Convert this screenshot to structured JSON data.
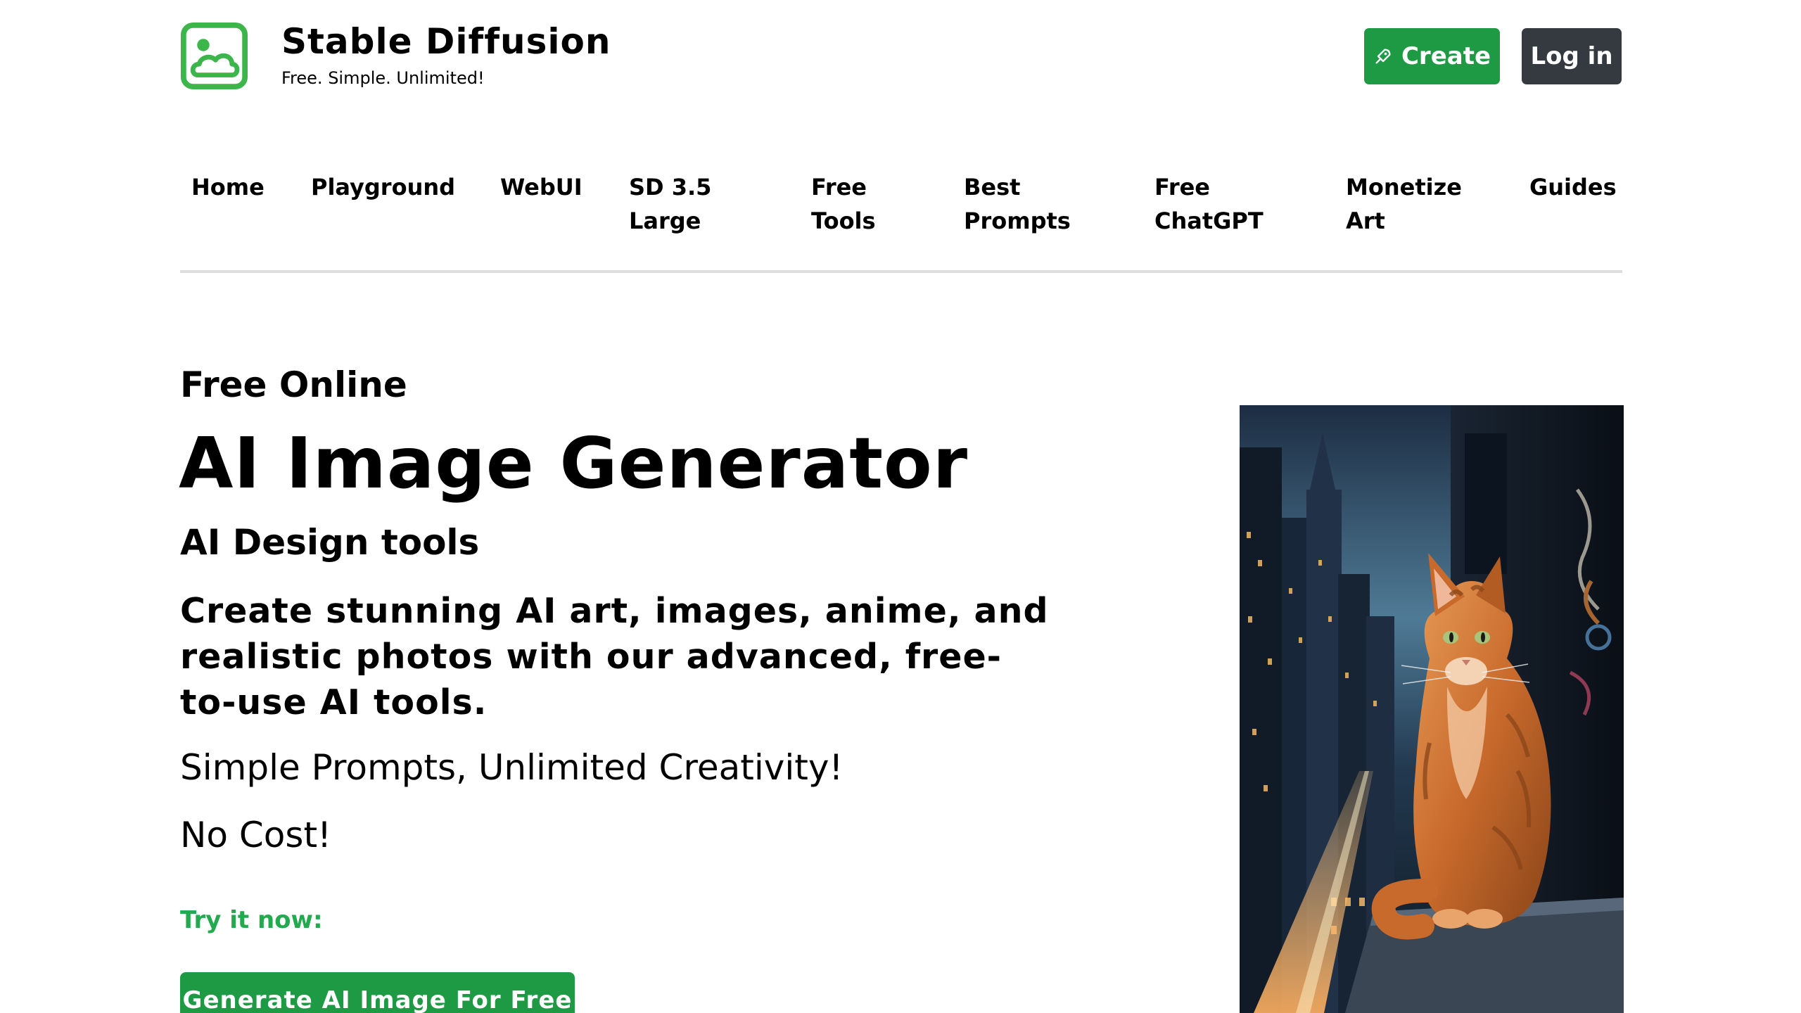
{
  "header": {
    "brand_title": "Stable Diffusion",
    "brand_tagline": "Free. Simple. Unlimited!",
    "logo_icon": "image-cloud-icon",
    "create_label": "Create",
    "create_icon": "rocket-icon",
    "login_label": "Log in"
  },
  "nav": {
    "items": [
      {
        "line1": "Home",
        "line2": ""
      },
      {
        "line1": "Playground",
        "line2": ""
      },
      {
        "line1": "WebUI",
        "line2": ""
      },
      {
        "line1": "SD 3.5",
        "line2": "Large"
      },
      {
        "line1": "Free",
        "line2": "Tools"
      },
      {
        "line1": "Best",
        "line2": "Prompts"
      },
      {
        "line1": "Free",
        "line2": "ChatGPT"
      },
      {
        "line1": "Monetize",
        "line2": "Art"
      },
      {
        "line1": "Guides",
        "line2": ""
      }
    ]
  },
  "hero": {
    "kicker": "Free Online",
    "headline": "AI Image Generator",
    "subhead": "AI Design tools",
    "description": "Create stunning AI art, images, anime, and realistic photos with our advanced, free-to-use AI tools.",
    "line1": "Simple Prompts, Unlimited Creativity!",
    "line2": "No Cost!",
    "try_label": "Try it now:",
    "cta_label": "Generate AI Image For Free",
    "image_subject": "orange tabby cat on a city window ledge at night"
  },
  "colors": {
    "brand_green": "#1e9a45",
    "accent_green": "#23a94e",
    "login_dark": "#343a40",
    "divider": "#dddddd"
  }
}
